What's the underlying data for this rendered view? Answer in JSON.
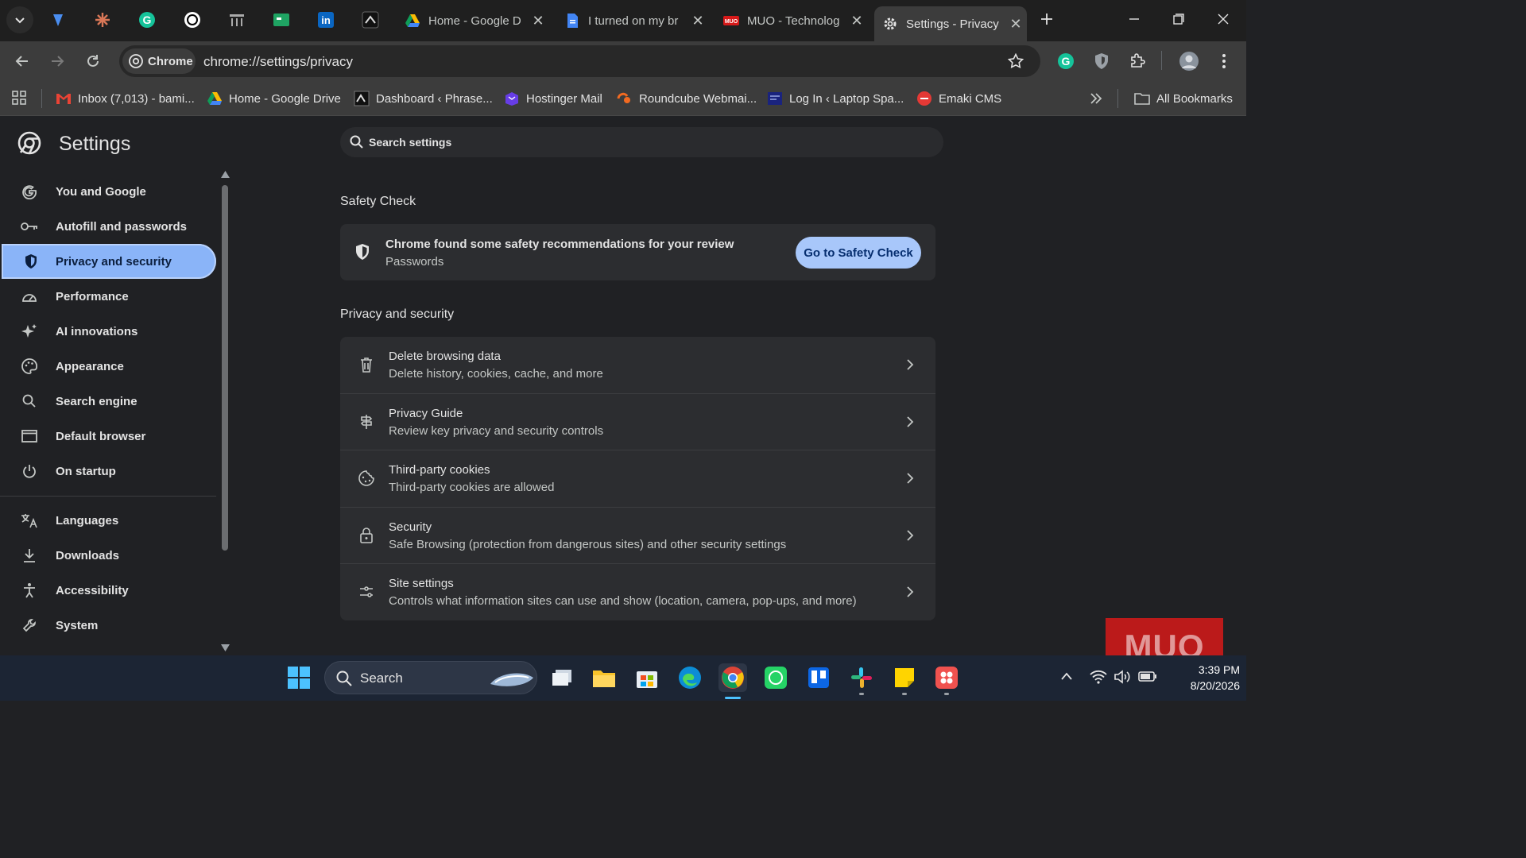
{
  "browser": {
    "tabs": [
      {
        "title": "Home - Google D",
        "icon": "google-drive-icon"
      },
      {
        "title": "I turned on my br",
        "icon": "google-docs-icon"
      },
      {
        "title": "MUO - Technolog",
        "icon": "muo-icon"
      },
      {
        "title": "Settings - Privacy",
        "icon": "gear-icon",
        "active": true
      }
    ],
    "chip_label": "Chrome",
    "url": "chrome://settings/privacy",
    "bookmarks": [
      {
        "label": "Inbox (7,013) - bami...",
        "icon": "gmail-icon"
      },
      {
        "label": "Home - Google Drive",
        "icon": "google-drive-icon"
      },
      {
        "label": "Dashboard ‹ Phrase...",
        "icon": "wordpress-icon"
      },
      {
        "label": "Hostinger Mail",
        "icon": "hostinger-icon"
      },
      {
        "label": "Roundcube Webmai...",
        "icon": "roundcube-icon"
      },
      {
        "label": "Log In ‹ Laptop Spa...",
        "icon": "laptop-icon"
      },
      {
        "label": "Emaki CMS",
        "icon": "emaki-icon"
      }
    ],
    "all_bookmarks": "All Bookmarks"
  },
  "settings": {
    "title": "Settings",
    "search_placeholder": "Search settings",
    "nav": [
      {
        "label": "You and Google",
        "icon": "google-g-icon"
      },
      {
        "label": "Autofill and passwords",
        "icon": "key-icon"
      },
      {
        "label": "Privacy and security",
        "icon": "shield-icon",
        "selected": true
      },
      {
        "label": "Performance",
        "icon": "speedometer-icon"
      },
      {
        "label": "AI innovations",
        "icon": "sparkle-icon"
      },
      {
        "label": "Appearance",
        "icon": "palette-icon"
      },
      {
        "label": "Search engine",
        "icon": "search-icon"
      },
      {
        "label": "Default browser",
        "icon": "browser-window-icon"
      },
      {
        "label": "On startup",
        "icon": "power-icon"
      },
      {
        "label": "Languages",
        "icon": "translate-icon"
      },
      {
        "label": "Downloads",
        "icon": "download-icon"
      },
      {
        "label": "Accessibility",
        "icon": "accessibility-icon"
      },
      {
        "label": "System",
        "icon": "wrench-icon"
      }
    ],
    "safety_check": {
      "heading": "Safety Check",
      "title": "Chrome found some safety recommendations for your review",
      "subtitle": "Passwords",
      "button": "Go to Safety Check"
    },
    "privacy": {
      "heading": "Privacy and security",
      "rows": [
        {
          "title": "Delete browsing data",
          "subtitle": "Delete history, cookies, cache, and more",
          "icon": "trash-icon"
        },
        {
          "title": "Privacy Guide",
          "subtitle": "Review key privacy and security controls",
          "icon": "privacy-guide-icon"
        },
        {
          "title": "Third-party cookies",
          "subtitle": "Third-party cookies are allowed",
          "icon": "cookie-icon"
        },
        {
          "title": "Security",
          "subtitle": "Safe Browsing (protection from dangerous sites) and other security settings",
          "icon": "lock-icon"
        },
        {
          "title": "Site settings",
          "subtitle": "Controls what information sites can use and show (location, camera, pop-ups, and more)",
          "icon": "sliders-icon"
        }
      ]
    }
  },
  "taskbar": {
    "search": "Search",
    "time": "3:39 PM",
    "date": "8/20/2026"
  },
  "watermark": "MUO",
  "colors": {
    "selected_nav": "#8ab4f8",
    "button": "#a8c7fa",
    "watermark": "#d71919"
  }
}
